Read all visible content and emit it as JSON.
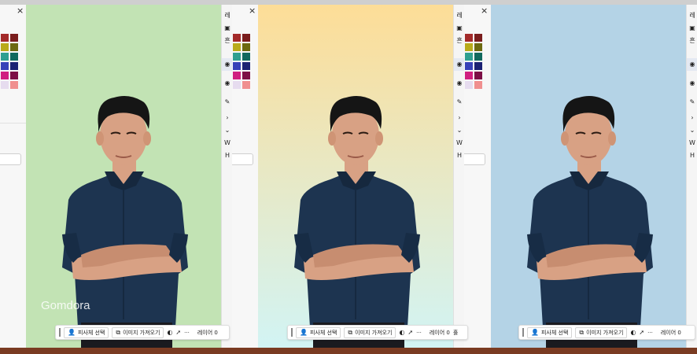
{
  "watermark": "Gomdora",
  "panels": [
    {
      "bg_top": "#c2e3b4",
      "bg_bottom": "#c2e3b4"
    },
    {
      "bg_top": "#fddd97",
      "bg_bottom": "#d2f4f4"
    },
    {
      "bg_top": "#b4d3e6",
      "bg_bottom": "#b4d3e6"
    }
  ],
  "toolbar": {
    "select_subject": "피사체 선택",
    "import_image": "이미지 가져오기",
    "more": "···",
    "layers": "레이어 0",
    "cut_label": "훌"
  },
  "panel_ui": {
    "close": "×",
    "label_top": "레",
    "label_fill": "흔",
    "label_w": "W",
    "label_h": "H"
  },
  "swatch_colors": [
    "#a32a2a",
    "#7a1d1d",
    "#b9ab1a",
    "#6d6a10",
    "#2f9f90",
    "#10695e",
    "#3741b8",
    "#1b2173",
    "#d01f80",
    "#7d0e46",
    "#e6dcef",
    "#f08f8f"
  ],
  "colors": {
    "shirt": "#1d3450",
    "skin": "#d8a184",
    "hair": "#151515"
  }
}
